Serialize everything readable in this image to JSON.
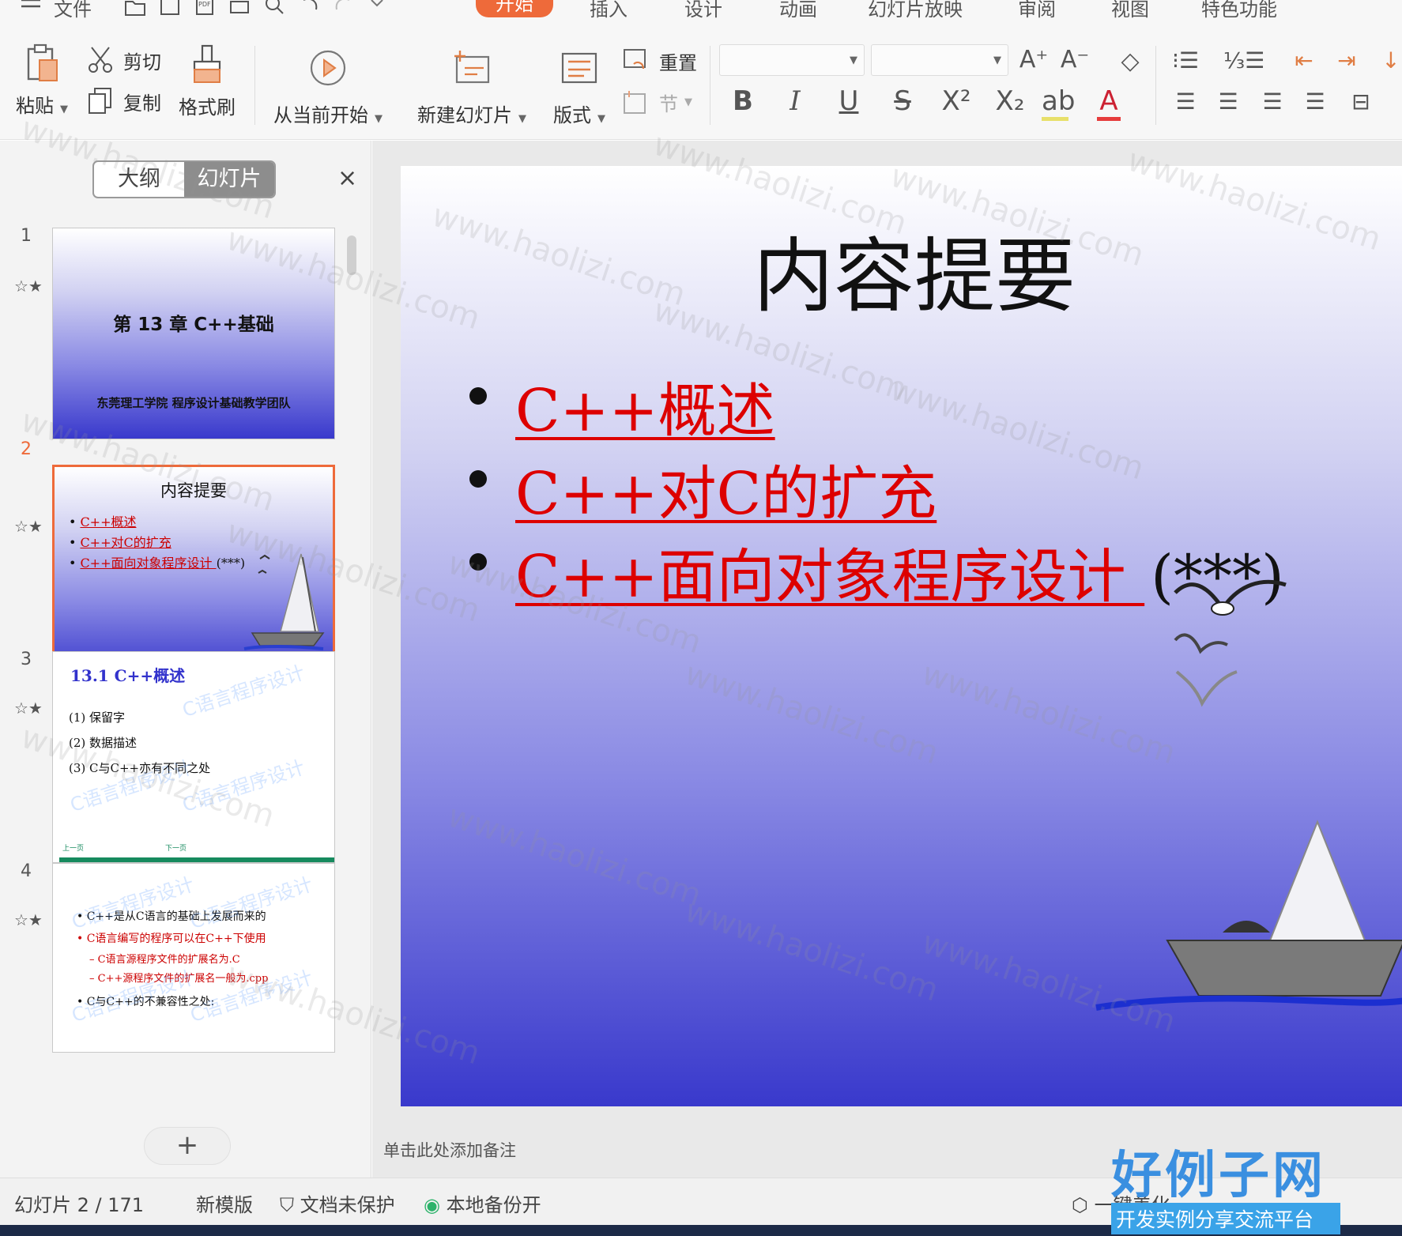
{
  "menu": {
    "file": "文件",
    "tabs": [
      "开始",
      "插入",
      "设计",
      "动画",
      "幻灯片放映",
      "审阅",
      "视图",
      "特色功能"
    ],
    "active_tab": "开始"
  },
  "ribbon": {
    "paste": "粘贴",
    "cut": "剪切",
    "copy": "复制",
    "format_painter": "格式刷",
    "play_from_current": "从当前开始",
    "new_slide": "新建幻灯片",
    "layout": "版式",
    "reset": "重置",
    "section": "节"
  },
  "panel": {
    "tab_outline": "大纲",
    "tab_slides": "幻灯片",
    "close": "×",
    "add": "+"
  },
  "thumbnails": [
    {
      "number": "1",
      "title": "第 13 章   C++基础",
      "subtitle": "东莞理工学院   程序设计基础教学团队"
    },
    {
      "number": "2",
      "title": "内容提要",
      "bullets": [
        "C++概述",
        "C++对C的扩充",
        "C++面向对象程序设计 "
      ],
      "bullet3_tail": "(***)"
    },
    {
      "number": "3",
      "title": "13.1 C++概述",
      "items": [
        "(1) 保留字",
        "(2) 数据描述",
        "(3) C与C++亦有不同之处"
      ],
      "nav_prev": "上一页",
      "nav_next": "下一页"
    },
    {
      "number": "4",
      "items": [
        "C++是从C语言的基础上发展而来的",
        "C语言编写的程序可以在C++下使用",
        "– C语言源程序文件的扩展名为.C",
        "– C++源程序文件的扩展名一般为.cpp",
        "C与C++的不兼容性之处:"
      ]
    }
  ],
  "thumb_watermark": "C语言程序设计",
  "slide": {
    "title": "内容提要",
    "bullets": [
      "C++概述",
      "C++对C的扩充",
      "C++面向对象程序设计 "
    ],
    "bullet3_tail": "(***)"
  },
  "notes_placeholder": "单击此处添加备注",
  "status": {
    "slide_info": "幻灯片 2 / 171",
    "template": "新模版",
    "protect": "文档未保护",
    "backup": "本地备份开",
    "beautify": "一键美化"
  },
  "watermark": "www.haolizi.com",
  "brand": {
    "name": "好例子网",
    "tagline": "开发实例分享交流平台"
  },
  "colors": {
    "accent": "#ee6a3a",
    "link_red": "#dd0000",
    "slide_bottom": "#3939cc",
    "brand_blue": "#3a8fe0"
  }
}
